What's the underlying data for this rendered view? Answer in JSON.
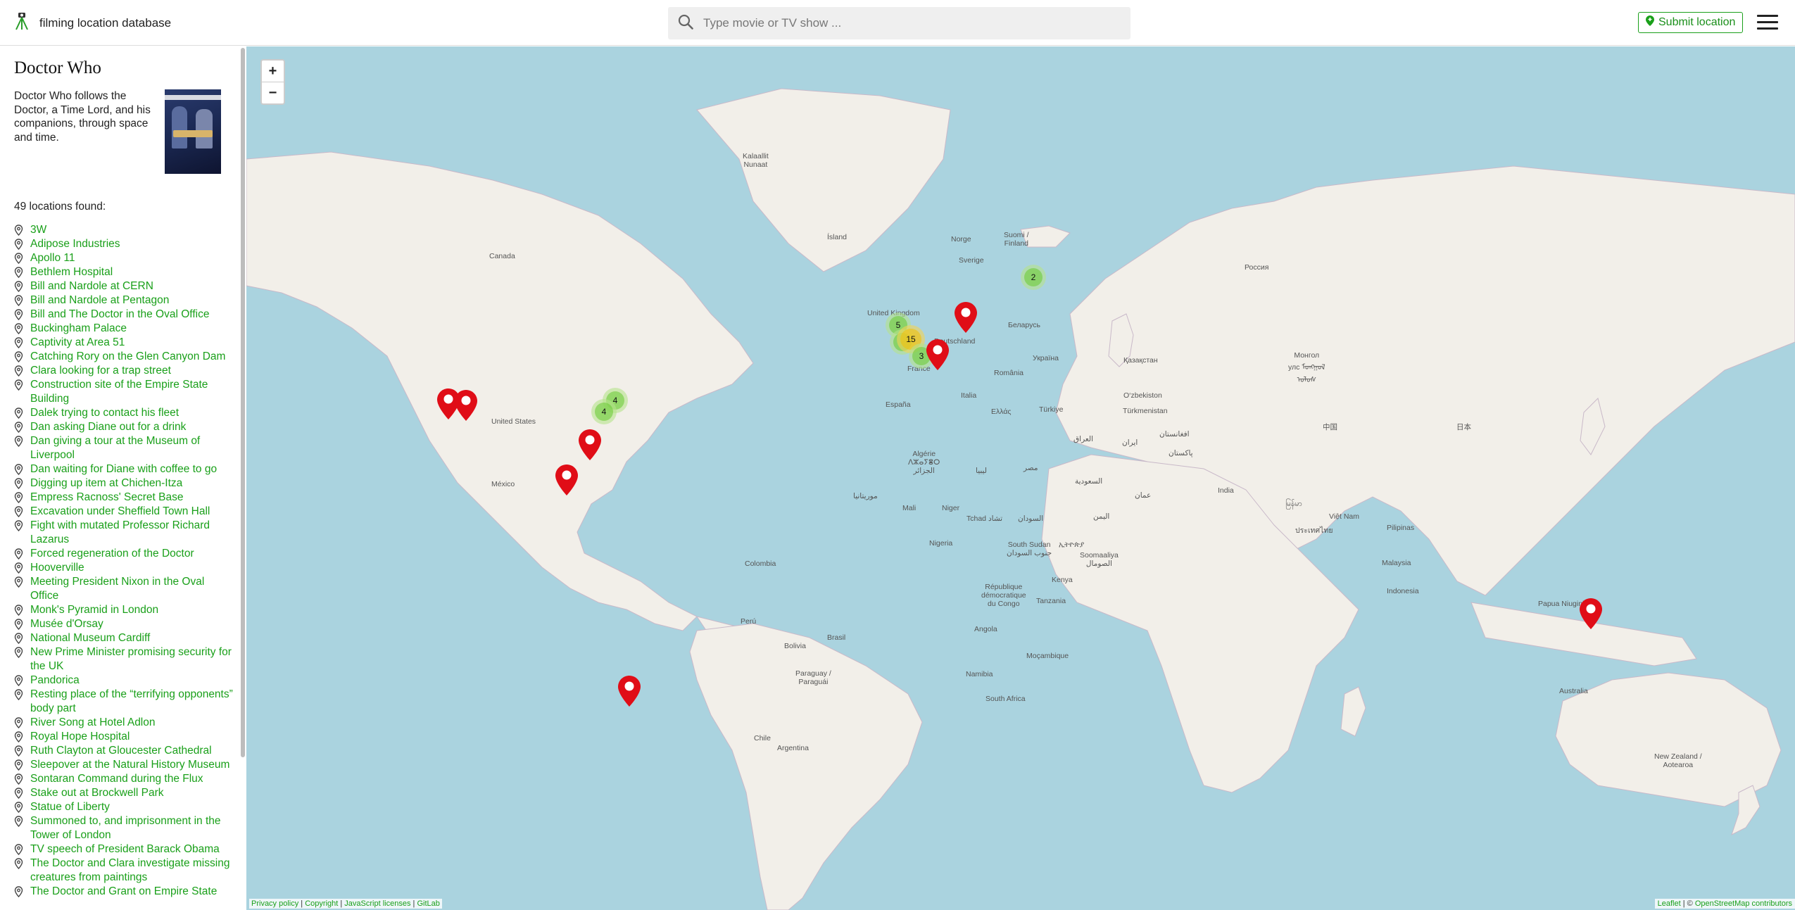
{
  "header": {
    "brand_title": "filming location database",
    "search_placeholder": "Type movie or TV show ...",
    "submit_label": "Submit location"
  },
  "sidebar": {
    "show_title": "Doctor Who",
    "description": "Doctor Who follows the Doctor, a Time Lord, and his companions, through space and time.",
    "count_text": "49 locations found:",
    "locations": [
      "3W",
      "Adipose Industries",
      "Apollo 11",
      "Bethlem Hospital",
      "Bill and Nardole at CERN",
      "Bill and Nardole at Pentagon",
      "Bill and The Doctor in the Oval Office",
      "Buckingham Palace",
      "Captivity at Area 51",
      "Catching Rory on the Glen Canyon Dam",
      "Clara looking for a trap street",
      "Construction site of the Empire State Building",
      "Dalek trying to contact his fleet",
      "Dan asking Diane out for a drink",
      "Dan giving a tour at the Museum of Liverpool",
      "Dan waiting for Diane with coffee to go",
      "Digging up item at Chichen-Itza",
      "Empress Racnoss' Secret Base",
      "Excavation under Sheffield Town Hall",
      "Fight with mutated Professor Richard Lazarus",
      "Forced regeneration of the Doctor",
      "Hooverville",
      "Meeting President Nixon in the Oval Office",
      "Monk's Pyramid in London",
      "Musée d'Orsay",
      "National Museum Cardiff",
      "New Prime Minister promising security for the UK",
      "Pandorica",
      "Resting place of the “terrifying opponents” body part",
      "River Song at Hotel Adlon",
      "Royal Hope Hospital",
      "Ruth Clayton at Gloucester Cathedral",
      "Sleepover at the Natural History Museum",
      "Sontaran Command during the Flux",
      "Stake out at Brockwell Park",
      "Statue of Liberty",
      "Summoned to, and imprisonment in the Tower of London",
      "TV speech of President Barack Obama",
      "The Doctor and Clara investigate missing creatures from paintings",
      "The Doctor and Grant on Empire State"
    ]
  },
  "map": {
    "zoom_in": "+",
    "zoom_out": "−",
    "clusters": [
      {
        "id": "finland",
        "count": "2",
        "size": "small"
      },
      {
        "id": "uk-a",
        "count": "5",
        "size": "small"
      },
      {
        "id": "uk-b",
        "count": "15",
        "size": "medium"
      },
      {
        "id": "france",
        "count": "3",
        "size": "small"
      },
      {
        "id": "us-east-a",
        "count": "4",
        "size": "small"
      },
      {
        "id": "us-east-b",
        "count": "4",
        "size": "small"
      }
    ],
    "labels": {
      "kalaallit": "Kalaallit\nNunaat",
      "island": "Ísland",
      "canada": "Canada",
      "norge": "Norge",
      "sverige": "Sverige",
      "suomi": "Suomi /\nFinland",
      "rossiya": "Россия",
      "uk": "United Kingdom",
      "deutschland": "Deutschland",
      "belarus": "Беларусь",
      "ukraina": "Україна",
      "kazakhstan": "Қазақстан",
      "mongol": "Монгол\nулс ᠮᠣᠩᠭᠣᠯ\nᠤᠯᠤᠰ",
      "france": "France",
      "romania": "România",
      "espana": "España",
      "italia": "Italia",
      "turkiye": "Türkiye",
      "ellas": "Ελλάς",
      "ozbekiston": "O‘zbekiston",
      "turkmenistan": "Türkmenistan",
      "zhongguo": "中国",
      "nihon": "日本",
      "united_states": "United States",
      "iraq": "العراق",
      "iran": "ایران",
      "afghanistan": "افغانستان",
      "pakistan": "پاکستان",
      "algerie": "Algérie\nⴷⵣⴰⵢⴻⵔ\nالجزائر",
      "libya": "ليبيا",
      "misr": "مصر",
      "saudi": "السعودية",
      "india": "India",
      "mexico": "México",
      "mauritania": "موريتانيا",
      "mali": "Mali",
      "niger": "Niger",
      "tchad": "Tchad تشاد",
      "sudan": "السودان",
      "yemen": "اليمن",
      "oman": "عمان",
      "myanmar": "မြန်မာ",
      "vietnam": "Việt Nam",
      "thailand": "ประเทศไทย",
      "pilipinas": "Pilipinas",
      "nigeria": "Nigeria",
      "southsudan": "South Sudan\nجنوب السودان",
      "ethiopia": "ኢትዮጵያ",
      "somalia": "Soomaaliya\nالصومال",
      "malaysia": "Malaysia",
      "colombia": "Colombia",
      "kenya": "Kenya",
      "drc": "République\ndémocratique\ndu Congo",
      "tanzania": "Tanzania",
      "indonesia": "Indonesia",
      "papua": "Papua Niugini",
      "peru": "Perú",
      "brasil": "Brasil",
      "bolivia": "Bolivia",
      "angola": "Angola",
      "mocambique": "Moçambique",
      "paraguay": "Paraguay /\nParaguái",
      "namibia": "Namibia",
      "southafrica": "South Africa",
      "australia": "Australia",
      "chile": "Chile",
      "argentina": "Argentina",
      "newzealand": "New Zealand /\nAotearoa"
    }
  },
  "footer": {
    "privacy": "Privacy policy",
    "copyright": "Copyright",
    "js_licenses": "JavaScript licenses",
    "gitlab": "GitLab",
    "leaflet": "Leaflet",
    "osm_prefix": "© ",
    "osm": "OpenStreetMap contributors"
  },
  "colors": {
    "accent": "#1aa01a",
    "marker_red": "#e00d17",
    "water": "#aad3df",
    "land": "#f2efe9"
  }
}
